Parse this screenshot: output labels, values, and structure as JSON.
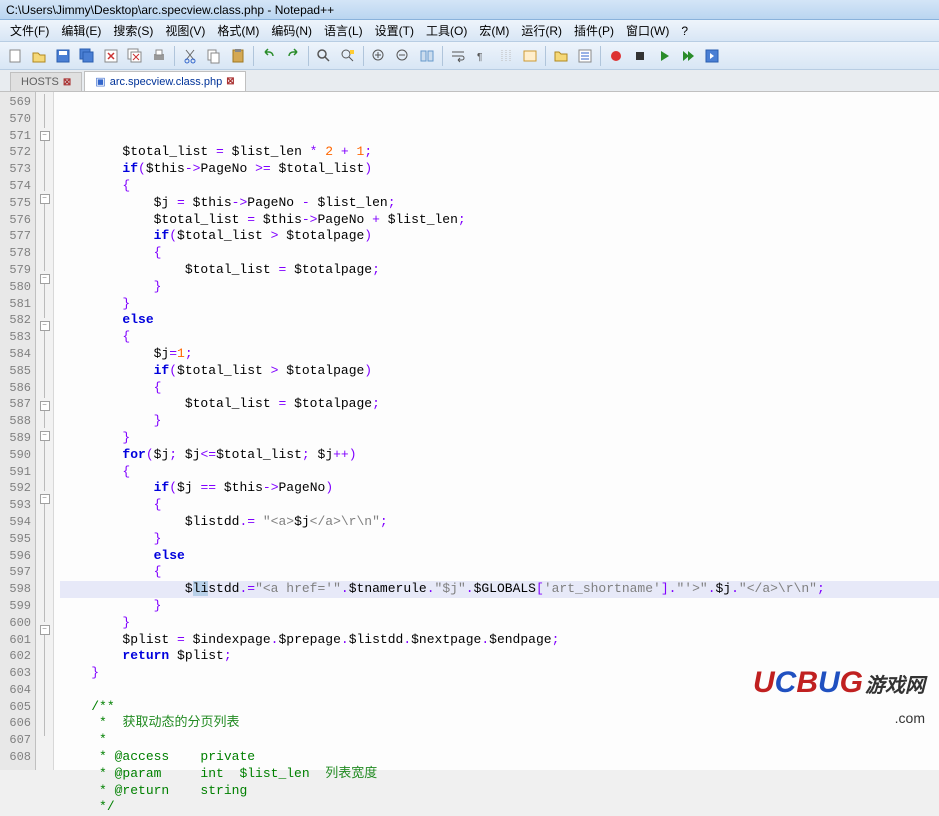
{
  "title": "C:\\Users\\Jimmy\\Desktop\\arc.specview.class.php - Notepad++",
  "menu": [
    "文件(F)",
    "编辑(E)",
    "搜索(S)",
    "视图(V)",
    "格式(M)",
    "编码(N)",
    "语言(L)",
    "设置(T)",
    "工具(O)",
    "宏(M)",
    "运行(R)",
    "插件(P)",
    "窗口(W)",
    "?"
  ],
  "tabs": [
    {
      "label": "HOSTS",
      "active": false
    },
    {
      "label": "arc.specview.class.php",
      "active": true
    }
  ],
  "line_numbers": [
    "569",
    "570",
    "571",
    "572",
    "573",
    "574",
    "575",
    "576",
    "577",
    "578",
    "579",
    "580",
    "581",
    "582",
    "583",
    "584",
    "585",
    "586",
    "587",
    "588",
    "589",
    "590",
    "591",
    "592",
    "593",
    "594",
    "595",
    "596",
    "597",
    "598",
    "599",
    "600",
    "601",
    "602",
    "603",
    "604",
    "605",
    "606",
    "607",
    "608"
  ],
  "highlight_line": 595,
  "code": {
    "l569": {
      "indent": "        ",
      "v1": "$total_list",
      "eq": " = ",
      "v2": "$list_len",
      "op": " * ",
      "n1": "2",
      "op2": " + ",
      "n2": "1",
      "end": ";"
    },
    "l570": {
      "indent": "        ",
      "kw": "if",
      "p1": "(",
      "v1": "$this",
      "arrow": "->",
      "prop": "PageNo",
      "op": " >= ",
      "v2": "$total_list",
      "p2": ")"
    },
    "l571": {
      "indent": "        ",
      "brace": "{"
    },
    "l572": {
      "indent": "            ",
      "v1": "$j",
      "eq": " = ",
      "v2": "$this",
      "arrow": "->",
      "prop": "PageNo",
      "op": " - ",
      "v3": "$list_len",
      "end": ";"
    },
    "l573": {
      "indent": "            ",
      "v1": "$total_list",
      "eq": " = ",
      "v2": "$this",
      "arrow": "->",
      "prop": "PageNo",
      "op": " + ",
      "v3": "$list_len",
      "end": ";"
    },
    "l574": {
      "indent": "            ",
      "kw": "if",
      "p1": "(",
      "v1": "$total_list",
      "op": " > ",
      "v2": "$totalpage",
      "p2": ")"
    },
    "l575": {
      "indent": "            ",
      "brace": "{"
    },
    "l576": {
      "indent": "                ",
      "v1": "$total_list",
      "eq": " = ",
      "v2": "$totalpage",
      "end": ";"
    },
    "l577": {
      "indent": "            ",
      "brace": "}"
    },
    "l578": {
      "indent": "        ",
      "brace": "}"
    },
    "l579": {
      "indent": "        ",
      "kw": "else"
    },
    "l580": {
      "indent": "        ",
      "brace": "{"
    },
    "l581": {
      "indent": "            ",
      "v1": "$j",
      "eq": "=",
      "n1": "1",
      "end": ";"
    },
    "l582": {
      "indent": "            ",
      "kw": "if",
      "p1": "(",
      "v1": "$total_list",
      "op": " > ",
      "v2": "$totalpage",
      "p2": ")"
    },
    "l583": {
      "indent": "            ",
      "brace": "{"
    },
    "l584": {
      "indent": "                ",
      "v1": "$total_list",
      "eq": " = ",
      "v2": "$totalpage",
      "end": ";"
    },
    "l585": {
      "indent": "            ",
      "brace": "}"
    },
    "l586": {
      "indent": "        ",
      "brace": "}"
    },
    "l587": {
      "indent": "        ",
      "kw": "for",
      "p1": "(",
      "v1": "$j",
      "semi": "; ",
      "v2": "$j",
      "op": "<=",
      "v3": "$total_list",
      "semi2": "; ",
      "v4": "$j",
      "inc": "++",
      "p2": ")"
    },
    "l588": {
      "indent": "        ",
      "brace": "{"
    },
    "l589": {
      "indent": "            ",
      "kw": "if",
      "p1": "(",
      "v1": "$j",
      "op": " == ",
      "v2": "$this",
      "arrow": "->",
      "prop": "PageNo",
      "p2": ")"
    },
    "l590": {
      "indent": "            ",
      "brace": "{"
    },
    "l591": {
      "indent": "                ",
      "v1": "$listdd",
      "dot": ".= ",
      "s1": "\"<a>",
      "v2": "$j",
      "s2": "</a>\\r\\n\"",
      "end": ";"
    },
    "l592": {
      "indent": "            ",
      "brace": "}"
    },
    "l593": {
      "indent": "            ",
      "kw": "else"
    },
    "l594": {
      "indent": "            ",
      "brace": "{"
    },
    "l595": {
      "indent": "                ",
      "v1a": "$",
      "sel": "li",
      "v1b": "stdd",
      "dot": ".=",
      "s1": "\"<a href='\"",
      "d1": ".",
      "v2": "$tnamerule",
      "d2": ".",
      "s2": "\"$j\"",
      "d3": ".",
      "v3": "$GLOBALS",
      "br1": "[",
      "s3": "'art_shortname'",
      "br2": "]",
      "d4": ".",
      "s4": "\"'>\"",
      "d5": ".",
      "v4": "$j",
      "d6": ".",
      "s5": "\"</a>\\r\\n\"",
      "end": ";"
    },
    "l596": {
      "indent": "            ",
      "brace": "}"
    },
    "l597": {
      "indent": "        ",
      "brace": "}"
    },
    "l598": {
      "indent": "        ",
      "v1": "$plist",
      "eq": " = ",
      "v2": "$indexpage",
      "d1": ".",
      "v3": "$prepage",
      "d2": ".",
      "v4": "$listdd",
      "d3": ".",
      "v5": "$nextpage",
      "d4": ".",
      "v6": "$endpage",
      "end": ";"
    },
    "l599": {
      "indent": "        ",
      "kw": "return",
      "sp": " ",
      "v1": "$plist",
      "end": ";"
    },
    "l600": {
      "indent": "    ",
      "brace": "}"
    },
    "l601": {
      "text": ""
    },
    "l602": {
      "indent": "    ",
      "cmt": "/**"
    },
    "l603": {
      "indent": "    ",
      "cmt": " *  ",
      "cn": "获取动态的分页列表"
    },
    "l604": {
      "indent": "    ",
      "cmt": " *"
    },
    "l605": {
      "indent": "    ",
      "cmt": " * @access    private"
    },
    "l606": {
      "indent": "    ",
      "cmt": " * @param     int  $list_len  ",
      "cn": "列表宽度"
    },
    "l607": {
      "indent": "    ",
      "cmt": " * @return    string"
    },
    "l608": {
      "indent": "    ",
      "cmt": " */"
    }
  },
  "watermark": {
    "brand": "UCBUG",
    "cn": "游戏网",
    "com": ".com"
  }
}
